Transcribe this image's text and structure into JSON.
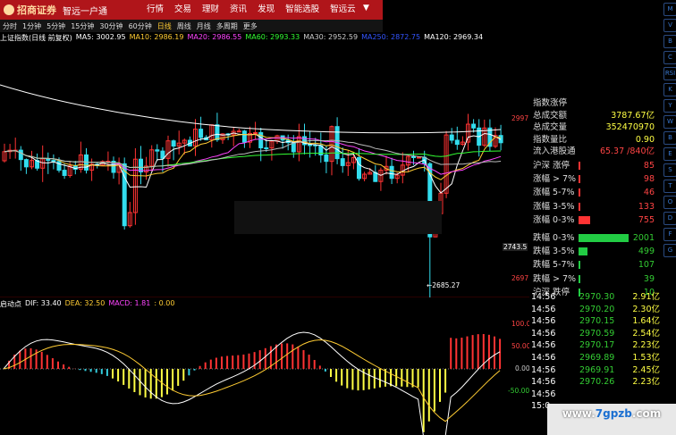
{
  "header": {
    "logo_text": "招商证券",
    "slogan": "智远一户通",
    "nav": [
      "行情",
      "交易",
      "理财",
      "资讯",
      "发现",
      "智能选股",
      "智远云"
    ]
  },
  "periodbar": {
    "items": [
      "分时",
      "1分钟",
      "5分钟",
      "15分钟",
      "30分钟",
      "60分钟",
      "日线",
      "周线",
      "月线",
      "多周期",
      "更多"
    ],
    "selected": "日线"
  },
  "ma_legend": {
    "title": "上证指数(日线 前复权)",
    "items": [
      {
        "label": "MA5: 3002.95",
        "color": "#ffffff"
      },
      {
        "label": "MA10: 2986.19",
        "color": "#ffcc33"
      },
      {
        "label": "MA20: 2986.55",
        "color": "#ff44ff"
      },
      {
        "label": "MA60: 2993.33",
        "color": "#33ff33"
      },
      {
        "label": "MA30: 2952.59",
        "color": "#cccccc"
      },
      {
        "label": "MA250: 2872.75",
        "color": "#3355ff"
      },
      {
        "label": "MA120: 2969.34",
        "color": "#ffffff"
      }
    ]
  },
  "price_labels": {
    "p2997": "2997",
    "p2743": "2743.5",
    "p2697": "2697",
    "low_mark": "←2685.27"
  },
  "macd_legend": {
    "title": "启动点",
    "dif": "DIF: 33.40",
    "dea": "DEA: 32.50",
    "macd": "MACD: 1.81",
    "extra": ": 0.00"
  },
  "macd_axis": [
    "100.0",
    "50.00",
    "0.00",
    "-50.00"
  ],
  "stats": [
    {
      "label": "指数涨停",
      "value": "",
      "color": "#ffffff"
    },
    {
      "label": "总成交额",
      "value": "3787.67亿",
      "color": "#ffff44"
    },
    {
      "label": "总成交量",
      "value": "352470970",
      "color": "#ffff44"
    },
    {
      "label": "指数量比",
      "value": "0.90",
      "color": "#ffff44"
    },
    {
      "label": "流入港股通",
      "value": "65.37 /840亿",
      "color": "#ff4444"
    }
  ],
  "breadth": [
    {
      "label": "沪深 涨停",
      "value": "85",
      "frac": 0.03,
      "color": "#ff3333"
    },
    {
      "label": "涨幅 > 7%",
      "value": "98",
      "frac": 0.03,
      "color": "#ff3333"
    },
    {
      "label": "涨幅 5-7%",
      "value": "46",
      "frac": 0.02,
      "color": "#ff3333"
    },
    {
      "label": "涨幅 3-5%",
      "value": "133",
      "frac": 0.04,
      "color": "#ff3333"
    },
    {
      "label": "涨幅 0-3%",
      "value": "755",
      "frac": 0.24,
      "color": "#ff3333"
    },
    {
      "label": "跌幅 0-3%",
      "value": "2001",
      "frac": 1.0,
      "color": "#22cc44"
    },
    {
      "label": "跌幅 3-5%",
      "value": "499",
      "frac": 0.17,
      "color": "#22cc44"
    },
    {
      "label": "跌幅 5-7%",
      "value": "107",
      "frac": 0.04,
      "color": "#22cc44"
    },
    {
      "label": "跌幅 > 7%",
      "value": "39",
      "frac": 0.015,
      "color": "#22cc44"
    },
    {
      "label": "沪深 跌停",
      "value": "10",
      "frac": 0.006,
      "color": "#22cc44"
    }
  ],
  "ticks": [
    {
      "time": "14:56",
      "price": "2970.30",
      "vol": "2.91亿"
    },
    {
      "time": "14:56",
      "price": "2970.20",
      "vol": "2.30亿"
    },
    {
      "time": "14:56",
      "price": "2970.15",
      "vol": "1.64亿"
    },
    {
      "time": "14:56",
      "price": "2970.59",
      "vol": "2.54亿"
    },
    {
      "time": "14:56",
      "price": "2970.17",
      "vol": "2.23亿"
    },
    {
      "time": "14:56",
      "price": "2969.89",
      "vol": "1.53亿"
    },
    {
      "time": "14:56",
      "price": "2969.91",
      "vol": "2.45亿"
    },
    {
      "time": "14:56",
      "price": "2970.26",
      "vol": "2.23亿"
    },
    {
      "time": "14:56",
      "price": "",
      "vol": ""
    },
    {
      "time": "15:0",
      "price": "",
      "vol": ""
    }
  ],
  "toolbar": [
    "M",
    "V",
    "B",
    "C",
    "RSI",
    "K",
    "Y",
    "W",
    "B",
    "E",
    "S",
    "T",
    "O",
    "D",
    "F",
    "G"
  ],
  "watermark": {
    "prefix": "www.",
    "main": "7gpzb",
    "suffix": ".com"
  }
}
